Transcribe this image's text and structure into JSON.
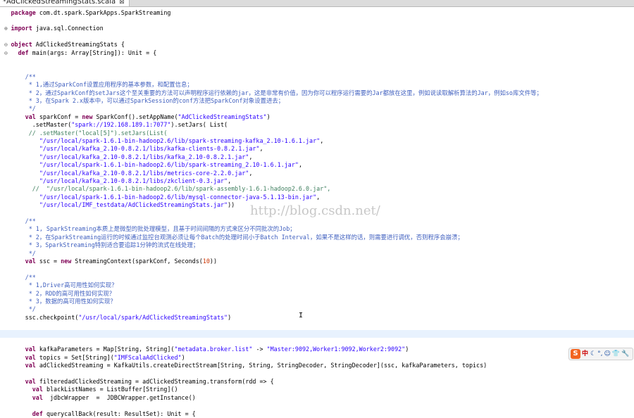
{
  "tab": {
    "title": "*AdClickedStreamingStats.scala",
    "close": "⊠"
  },
  "code": [
    [
      [
        "kw",
        "package"
      ],
      [
        "t",
        " com.dt.spark.SparkApps.SparkStreaming"
      ]
    ],
    [],
    [
      [
        "kw",
        "import"
      ],
      [
        "t",
        " java.sql.Connection"
      ]
    ],
    [],
    [
      [
        "kw",
        "object"
      ],
      [
        "t",
        " AdClickedStreamingStats {"
      ]
    ],
    [
      [
        "t",
        "  "
      ],
      [
        "kw",
        "def"
      ],
      [
        "t",
        " main(args: Array[String]): Unit = {"
      ]
    ],
    [],
    [],
    [
      [
        "cm",
        "    /**"
      ]
    ],
    [
      [
        "cm",
        "     * 1,通过SparkConf设置应用程序的基本参数，和配置信息；"
      ]
    ],
    [
      [
        "cm",
        "     * 2，通过SparkConf的setJars这个至关重要的方法可以声明程序运行依赖的jar，这是非常有价值，因为你可以程序运行需要的Jar都放在这里，例如说读取解析算法的Jar，例如so库文件等；"
      ]
    ],
    [
      [
        "cm",
        "     * 3，在Spark 2.x版本中，可以通过SparkSession的conf方法把SparkConf对象设置进去；"
      ]
    ],
    [
      [
        "cm",
        "     */"
      ]
    ],
    [
      [
        "t",
        "    "
      ],
      [
        "kw",
        "val"
      ],
      [
        "t",
        " sparkConf = "
      ],
      [
        "kw",
        "new"
      ],
      [
        "t",
        " SparkConf().setAppName("
      ],
      [
        "str",
        "\"AdClickedStreamingStats\""
      ],
      [
        "t",
        ")"
      ]
    ],
    [
      [
        "t",
        "      .setMaster("
      ],
      [
        "str",
        "\"spark://192.168.189.1:7077\""
      ],
      [
        "t",
        ").setJars( List("
      ]
    ],
    [
      [
        "lc",
        "     // .setMaster(\"local[5]\").setJars(List("
      ]
    ],
    [
      [
        "t",
        "        "
      ],
      [
        "str",
        "\"/usr/local/spark-1.6.1-bin-hadoop2.6/lib/spark-streaming-kafka_2.10-1.6.1.jar\""
      ],
      [
        "t",
        ","
      ]
    ],
    [
      [
        "t",
        "        "
      ],
      [
        "str",
        "\"/usr/local/kafka_2.10-0.8.2.1/libs/kafka-clients-0.8.2.1.jar\""
      ],
      [
        "t",
        ","
      ]
    ],
    [
      [
        "t",
        "        "
      ],
      [
        "str",
        "\"/usr/local/kafka_2.10-0.8.2.1/libs/kafka_2.10-0.8.2.1.jar\""
      ],
      [
        "t",
        ","
      ]
    ],
    [
      [
        "t",
        "        "
      ],
      [
        "str",
        "\"/usr/local/spark-1.6.1-bin-hadoop2.6/lib/spark-streaming_2.10-1.6.1.jar\""
      ],
      [
        "t",
        ","
      ]
    ],
    [
      [
        "t",
        "        "
      ],
      [
        "str",
        "\"/usr/local/kafka_2.10-0.8.2.1/libs/metrics-core-2.2.0.jar\""
      ],
      [
        "t",
        ","
      ]
    ],
    [
      [
        "t",
        "        "
      ],
      [
        "str",
        "\"/usr/local/kafka_2.10-0.8.2.1/libs/zkclient-0.3.jar\""
      ],
      [
        "t",
        ","
      ]
    ],
    [
      [
        "lc",
        "      //  \"/usr/local/spark-1.6.1-bin-hadoop2.6/lib/spark-assembly-1.6.1-hadoop2.6.0.jar\","
      ]
    ],
    [
      [
        "t",
        "        "
      ],
      [
        "str",
        "\"/usr/local/spark-1.6.1-bin-hadoop2.6/lib/mysql-connector-java-5.1.13-bin.jar\""
      ],
      [
        "t",
        ","
      ]
    ],
    [
      [
        "t",
        "        "
      ],
      [
        "str",
        "\"/usr/local/IMF_testdata/AdClickedStreamingStats.jar\""
      ],
      [
        "t",
        "))"
      ]
    ],
    [],
    [
      [
        "cm",
        "    /**"
      ]
    ],
    [
      [
        "cm",
        "     * 1, SparkStreaming本质上是微型的批处理模型，且基于时间间隔的方式来区分不同批次的Job；"
      ]
    ],
    [
      [
        "cm",
        "     * 2，在SparkStreaming运行的时候通过监控台观测必须让每个Batch的处理时间小于Batch Interval，如果不是这样的话，则需要进行调优，否则程序会崩溃；"
      ]
    ],
    [
      [
        "cm",
        "     * 3，SparkStreaming特别适合要追踪1分钟的流式在线处理；"
      ]
    ],
    [
      [
        "cm",
        "     */"
      ]
    ],
    [
      [
        "t",
        "    "
      ],
      [
        "kw",
        "val"
      ],
      [
        "t",
        " ssc = "
      ],
      [
        "kw",
        "new"
      ],
      [
        "t",
        " StreamingContext(sparkConf, Seconds("
      ],
      [
        "num",
        "10"
      ],
      [
        "t",
        "))"
      ]
    ],
    [],
    [
      [
        "cm",
        "    /**"
      ]
    ],
    [
      [
        "cm",
        "     * 1,Driver高可用性如何实现？"
      ]
    ],
    [
      [
        "cm",
        "     * 2，RDD的高可用性如何实现？"
      ]
    ],
    [
      [
        "cm",
        "     * 3，数据的高可用性如何实现？"
      ]
    ],
    [
      [
        "cm",
        "     */"
      ]
    ],
    [
      [
        "t",
        "    ssc.checkpoint("
      ],
      [
        "str",
        "\"/usr/local/spark/AdClickedStreamingStats\""
      ],
      [
        "t",
        ")"
      ]
    ],
    [],
    [],
    [],
    [
      [
        "t",
        "    "
      ],
      [
        "kw",
        "val"
      ],
      [
        "t",
        " kafkaParameters = Map[String, String]("
      ],
      [
        "str",
        "\"metadata.broker.list\""
      ],
      [
        "t",
        " -> "
      ],
      [
        "str",
        "\"Master:9092,Worker1:9092,Worker2:9092\""
      ],
      [
        "t",
        ")"
      ]
    ],
    [
      [
        "t",
        "    "
      ],
      [
        "kw",
        "val"
      ],
      [
        "t",
        " topics = Set[String]("
      ],
      [
        "str",
        "\"IMFScalaAdClicked\""
      ],
      [
        "t",
        ")"
      ]
    ],
    [
      [
        "t",
        "    "
      ],
      [
        "kw",
        "val"
      ],
      [
        "t",
        " adClickedStreaming = KafkaUtils.createDirectStream[String, String, StringDecoder, StringDecoder](ssc, kafkaParameters, topics)"
      ]
    ],
    [],
    [
      [
        "t",
        "    "
      ],
      [
        "kw",
        "val"
      ],
      [
        "t",
        " filteredadClickedStreaming = adClickedStreaming.transform(rdd => {"
      ]
    ],
    [
      [
        "t",
        "      "
      ],
      [
        "kw",
        "val"
      ],
      [
        "t",
        " blackListNames = ListBuffer[String]()"
      ]
    ],
    [
      [
        "t",
        "      "
      ],
      [
        "kw",
        "val"
      ],
      [
        "t",
        "  jdbcWrapper  =  JDBCWrapper.getInstance()"
      ]
    ],
    [],
    [
      [
        "t",
        "      "
      ],
      [
        "kw",
        "def"
      ],
      [
        "t",
        " querycallBack(result: ResultSet): Unit = {"
      ]
    ]
  ],
  "folds": {
    "0": "",
    "2": "⊕",
    "4": "⊖",
    "5": "⊖"
  },
  "watermark": "http://blog.csdn.net/",
  "ime": {
    "logo": "S",
    "mode": "中",
    "icons": [
      "☾",
      "°,",
      "☺",
      "👕",
      "🔧"
    ]
  }
}
